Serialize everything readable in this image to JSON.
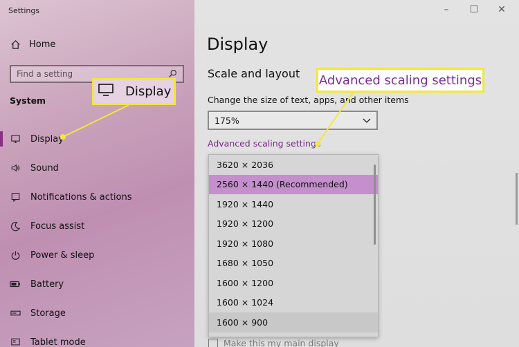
{
  "window": {
    "title": "Settings"
  },
  "sidebar": {
    "home_label": "Home",
    "search_placeholder": "Find a setting",
    "section_header": "System",
    "items": [
      {
        "label": "Display",
        "icon": "monitor-icon",
        "active": true
      },
      {
        "label": "Sound",
        "icon": "speaker-icon"
      },
      {
        "label": "Notifications & actions",
        "icon": "notification-icon"
      },
      {
        "label": "Focus assist",
        "icon": "moon-icon"
      },
      {
        "label": "Power & sleep",
        "icon": "power-icon"
      },
      {
        "label": "Battery",
        "icon": "battery-icon"
      },
      {
        "label": "Storage",
        "icon": "storage-icon"
      },
      {
        "label": "Tablet mode",
        "icon": "tablet-icon"
      }
    ]
  },
  "main": {
    "title": "Display",
    "section_title": "Scale and layout",
    "scale_label": "Change the size of text, apps, and other items",
    "scale_value": "175%",
    "advanced_link": "Advanced scaling settings",
    "resolution_options": [
      "3620 × 2036",
      "2560 × 1440 (Recommended)",
      "1920 × 1440",
      "1920 × 1200",
      "1920 × 1080",
      "1680 × 1050",
      "1600 × 1200",
      "1600 × 1024",
      "1600 × 900"
    ],
    "selected_resolution": "2560 × 1440 (Recommended)",
    "main_display_label": "Make this my main display"
  },
  "callouts": {
    "display_label": "Display",
    "advanced_label": "Advanced scaling settings",
    "border_color": "#f3e83a"
  },
  "colors": {
    "accent": "#8a2f86",
    "link": "#7a2a8a",
    "selected_row": "#c48fcc"
  }
}
